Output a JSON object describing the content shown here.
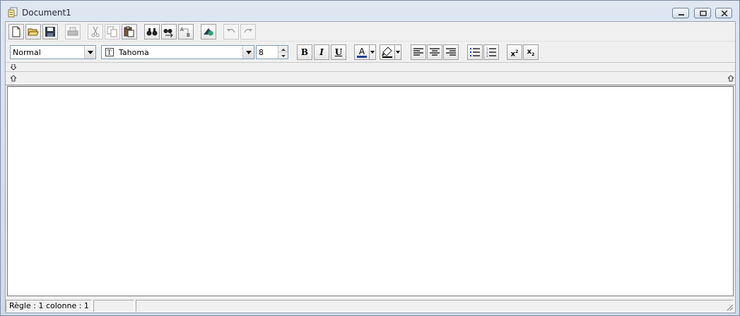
{
  "window": {
    "title": "Document1"
  },
  "toolbar": {
    "buttons": [
      {
        "name": "new-document-icon"
      },
      {
        "name": "open-folder-icon"
      },
      {
        "name": "save-icon"
      },
      {
        "name": "print-icon"
      },
      {
        "name": "cut-icon"
      },
      {
        "name": "copy-icon"
      },
      {
        "name": "paste-icon"
      },
      {
        "name": "find-icon"
      },
      {
        "name": "find-next-icon"
      },
      {
        "name": "replace-icon"
      },
      {
        "name": "insert-object-icon"
      },
      {
        "name": "undo-icon"
      },
      {
        "name": "redo-icon"
      }
    ]
  },
  "format": {
    "style_value": "Normal",
    "font_value": "Tahoma",
    "size_value": "8",
    "bold_label": "B",
    "italic_label": "I",
    "underline_label": "U",
    "font_color_label": "A",
    "superscript_label": "x",
    "superscript_mark": "2",
    "subscript_label": "x",
    "subscript_mark": "2",
    "colors": {
      "font_color_bar": "#1c3fa0",
      "highlight_bar": "#000000"
    }
  },
  "statusbar": {
    "rule_label": "Règle :",
    "rule_value": "1",
    "column_label": "colonne :",
    "column_value": "1"
  }
}
